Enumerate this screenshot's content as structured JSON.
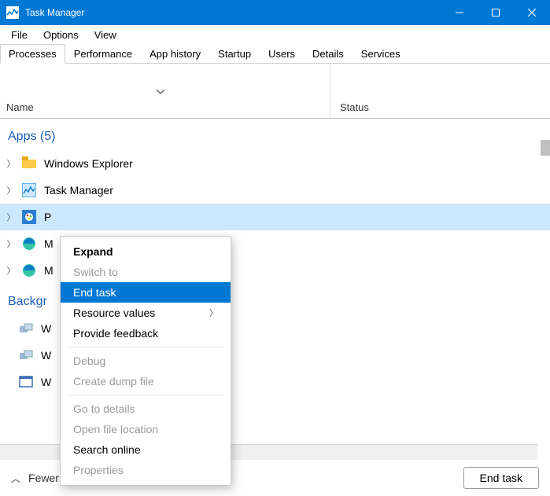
{
  "window": {
    "title": "Task Manager"
  },
  "menu": {
    "file": "File",
    "options": "Options",
    "view": "View"
  },
  "tabs": {
    "processes": "Processes",
    "performance": "Performance",
    "app_history": "App history",
    "startup": "Startup",
    "users": "Users",
    "details": "Details",
    "services": "Services"
  },
  "columns": {
    "name": "Name",
    "status": "Status"
  },
  "groups": {
    "apps": "Apps (5)",
    "background": "Backgr"
  },
  "apps": [
    {
      "name": "Windows Explorer",
      "icon": "folder"
    },
    {
      "name": "Task Manager",
      "icon": "taskmgr"
    },
    {
      "name": "P",
      "icon": "paint",
      "selected": true,
      "truncated": true
    },
    {
      "name": "M",
      "icon": "edge",
      "truncated": true
    },
    {
      "name": "M",
      "icon": "edge",
      "truncated": true
    }
  ],
  "background": [
    {
      "name": "W",
      "icon": "wmi",
      "truncated": true
    },
    {
      "name": "W",
      "icon": "wmi",
      "truncated": true
    },
    {
      "name": "W",
      "icon": "winframe",
      "truncated": true
    }
  ],
  "context_menu": {
    "expand": "Expand",
    "switch_to": "Switch to",
    "end_task": "End task",
    "resource_values": "Resource values",
    "provide_feedback": "Provide feedback",
    "debug": "Debug",
    "create_dump": "Create dump file",
    "go_to_details": "Go to details",
    "open_file_location": "Open file location",
    "search_online": "Search online",
    "properties": "Properties"
  },
  "footer": {
    "fewer": "Fewer details",
    "end_task": "End task"
  }
}
